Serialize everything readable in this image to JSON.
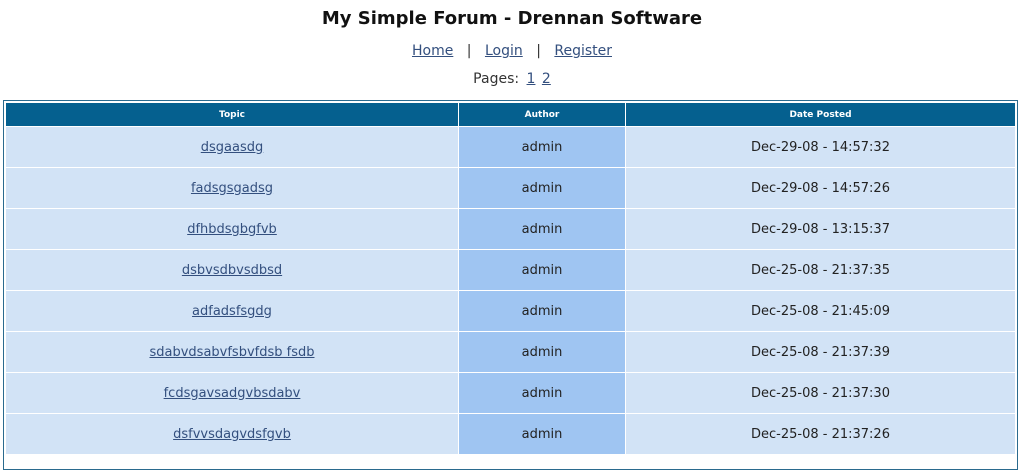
{
  "page": {
    "title": "My Simple Forum - Drennan Software"
  },
  "nav": {
    "home": "Home",
    "sep1": "|",
    "login": "Login",
    "sep2": "|",
    "register": "Register"
  },
  "pagination": {
    "label": "Pages:",
    "pages": [
      "1",
      "2"
    ]
  },
  "table": {
    "headers": {
      "topic": "Topic",
      "author": "Author",
      "date": "Date Posted"
    },
    "rows": [
      {
        "topic": "dsgaasdg",
        "author": "admin",
        "date": "Dec-29-08 - 14:57:32"
      },
      {
        "topic": "fadsgsgadsg",
        "author": "admin",
        "date": "Dec-29-08 - 14:57:26"
      },
      {
        "topic": "dfhbdsgbgfvb",
        "author": "admin",
        "date": "Dec-29-08 - 13:15:37"
      },
      {
        "topic": "dsbvsdbvsdbsd",
        "author": "admin",
        "date": "Dec-25-08 - 21:37:35"
      },
      {
        "topic": "adfadsfsgdg",
        "author": "admin",
        "date": "Dec-25-08 - 21:45:09"
      },
      {
        "topic": "sdabvdsabvfsbvfdsb fsdb",
        "author": "admin",
        "date": "Dec-25-08 - 21:37:39"
      },
      {
        "topic": "fcdsgavsadgvbsdabv",
        "author": "admin",
        "date": "Dec-25-08 - 21:37:30"
      },
      {
        "topic": "dsfvvsdagvdsfgvb",
        "author": "admin",
        "date": "Dec-25-08 - 21:37:26"
      }
    ]
  }
}
